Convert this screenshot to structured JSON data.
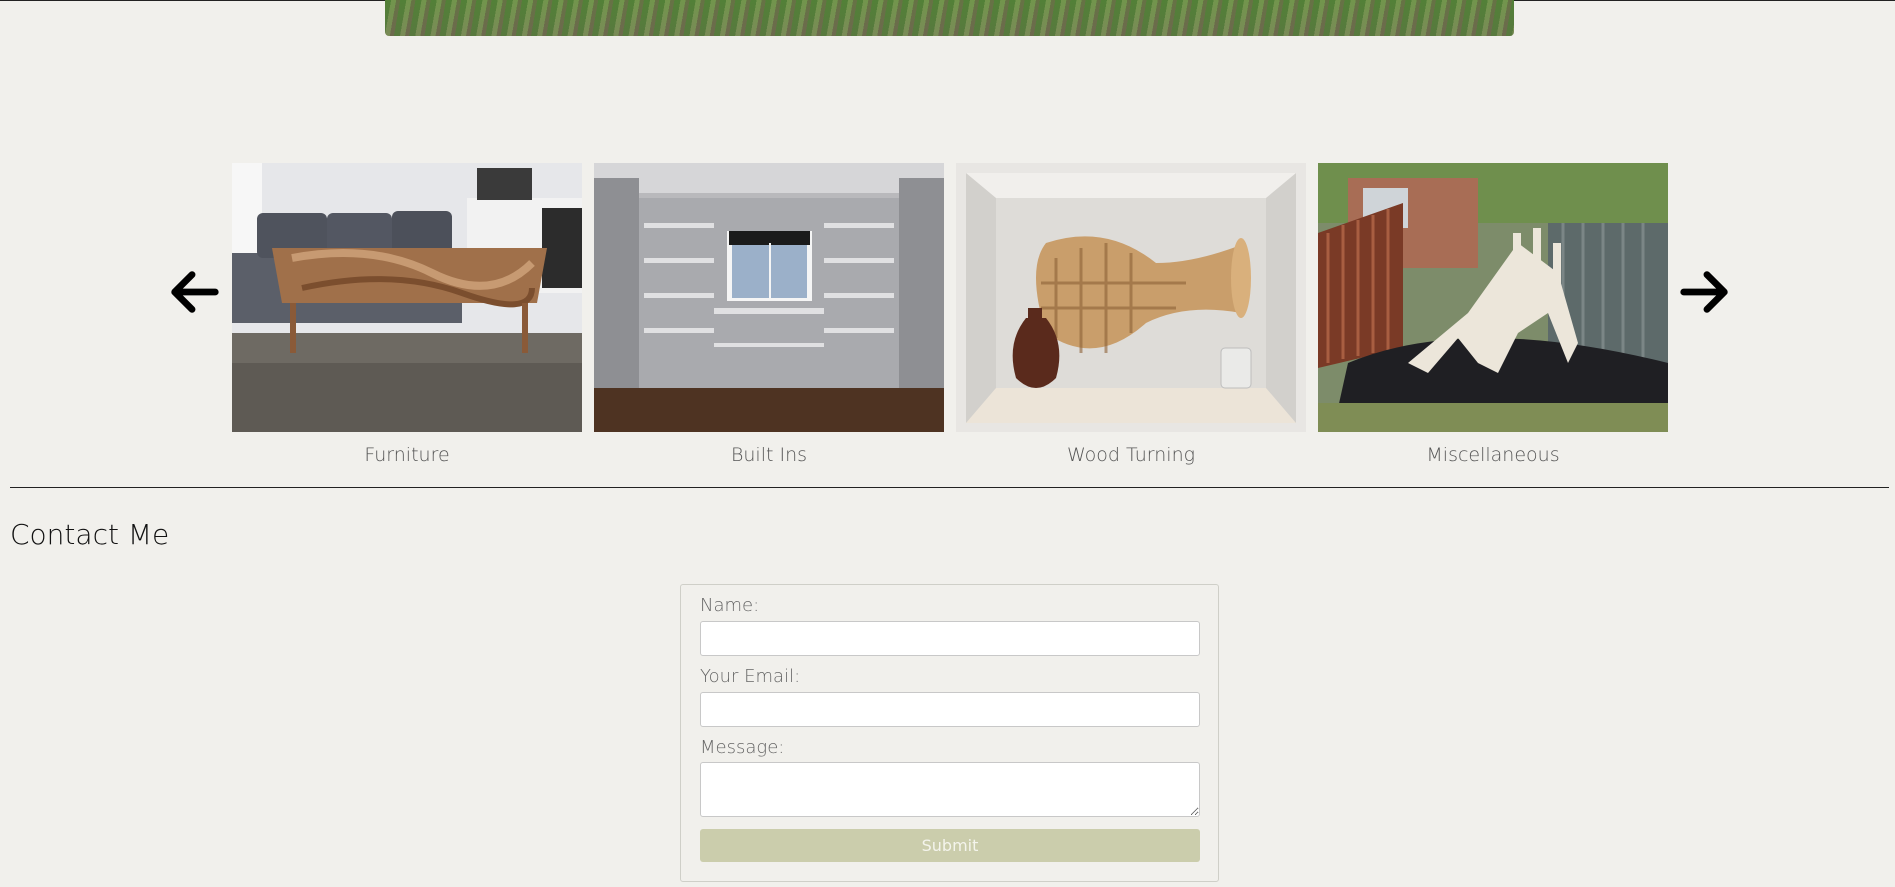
{
  "carousel": {
    "prev_icon": "arrow-left-icon",
    "next_icon": "arrow-right-icon",
    "items": [
      {
        "label": "Furniture"
      },
      {
        "label": "Built Ins"
      },
      {
        "label": "Wood Turning"
      },
      {
        "label": "Miscellaneous"
      }
    ]
  },
  "contact": {
    "title": "Contact Me",
    "name_label": "Name:",
    "email_label": "Your Email:",
    "message_label": "Message:",
    "submit_label": "Submit"
  },
  "colors": {
    "background": "#f1f0ec",
    "submit": "#cbcdac"
  }
}
